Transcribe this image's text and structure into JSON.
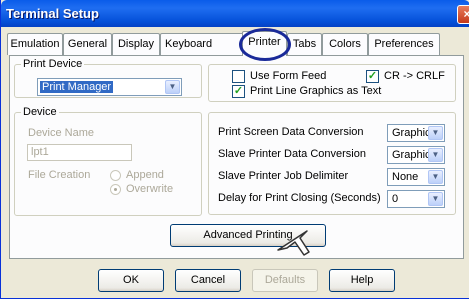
{
  "window": {
    "title": "Terminal Setup",
    "close_glyph": "×"
  },
  "tabs": [
    {
      "label": "Emulation",
      "selected": false
    },
    {
      "label": "General",
      "selected": false
    },
    {
      "label": "Display",
      "selected": false
    },
    {
      "label": "Keyboard",
      "selected": false
    },
    {
      "label": "Printer",
      "selected": true
    },
    {
      "label": "Tabs",
      "selected": false
    },
    {
      "label": "Colors",
      "selected": false
    },
    {
      "label": "Preferences",
      "selected": false
    }
  ],
  "print_device": {
    "legend": "Print Device",
    "selected": "Print Manager"
  },
  "options": {
    "use_form_feed": {
      "label": "Use Form Feed",
      "checked": false
    },
    "cr_crlf": {
      "label": "CR -> CRLF",
      "checked": true
    },
    "line_graphics": {
      "label": "Print Line Graphics as Text",
      "checked": true
    }
  },
  "device": {
    "legend": "Device",
    "name_label": "Device Name",
    "name_value": "lpt1",
    "file_creation_label": "File Creation",
    "append_label": "Append",
    "overwrite_label": "Overwrite",
    "selected_mode": "Overwrite"
  },
  "conversion": {
    "print_screen": {
      "label": "Print Screen Data Conversion",
      "value": "Graphic"
    },
    "slave_printer": {
      "label": "Slave Printer Data Conversion",
      "value": "Graphic"
    },
    "job_delimiter": {
      "label": "Slave Printer Job Delimiter",
      "value": "None"
    },
    "delay": {
      "label": "Delay for Print Closing (Seconds)",
      "value": "0"
    }
  },
  "advanced_button": "Advanced Printing",
  "buttons": {
    "ok": "OK",
    "cancel": "Cancel",
    "defaults": "Defaults",
    "help": "Help"
  },
  "colors": {
    "title_bar": "#0a5ce9",
    "dialog_bg": "#ece9d8",
    "annotation": "#1a2a99"
  }
}
